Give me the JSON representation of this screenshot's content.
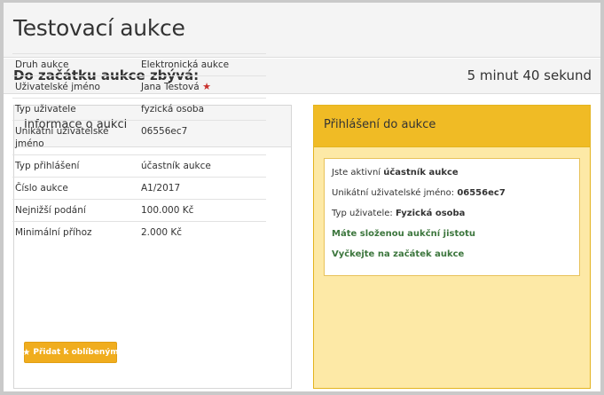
{
  "page": {
    "title": "Testovací aukce"
  },
  "countdown": {
    "label": "Do začátku aukce zbývá:",
    "value": "5 minut 40 sekund"
  },
  "info_panel": {
    "title": "Informace o aukci",
    "rows": [
      {
        "key": "Druh aukce",
        "value": "Elektronická aukce"
      },
      {
        "key": "Uživatelské jméno",
        "value": "Jana Testová"
      },
      {
        "key": "Typ uživatele",
        "value": "fyzická osoba"
      },
      {
        "key": "Unikátní uživatelské jméno",
        "value": "06556ec7"
      },
      {
        "key": "Typ přihlášení",
        "value": "účastník aukce"
      },
      {
        "key": "Číslo aukce",
        "value": "A1/2017"
      },
      {
        "key": "Nejnižší podání",
        "value": "100.000 Kč"
      },
      {
        "key": "Minimální příhoz",
        "value": "2.000 Kč"
      }
    ],
    "favorite_button": "Přidat k oblíbeným"
  },
  "login_panel": {
    "title": "Přihlášení do aukce",
    "active_prefix": "Jste aktivní ",
    "active_role": "účastník aukce",
    "username_prefix": "Unikátní uživatelské jméno: ",
    "username_value": "06556ec7",
    "usertype_prefix": "Typ uživatele: ",
    "usertype_value": "Fyzická osoba",
    "deposit_message": "Máte složenou aukční jistotu",
    "wait_message": "Vyčkejte na začátek aukce"
  },
  "colors": {
    "accent_yellow": "#f0bb25",
    "panel_yellow": "#fde9a6",
    "success_green": "#3c763d",
    "favorite_star": "#c9302c"
  },
  "icons": {
    "user_star": "star-icon",
    "favorite": "star-icon"
  }
}
